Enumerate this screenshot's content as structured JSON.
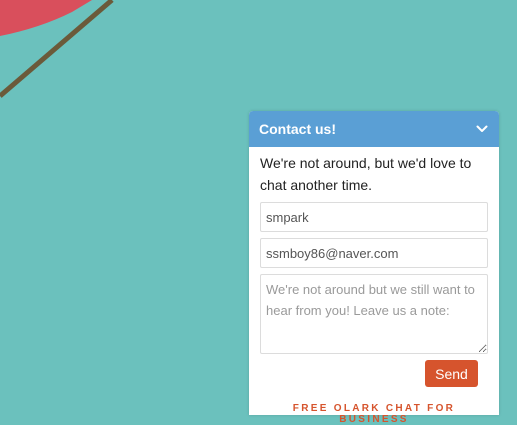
{
  "widget": {
    "title": "Contact us!",
    "away_message": "We're not around, but we'd love to chat another time.",
    "name_value": "smpark",
    "email_value": "ssmboy86@naver.com",
    "note_placeholder": "We're not around but we still want to hear from you! Leave us a note:",
    "send_label": "Send",
    "footer_link": "FREE OLARK CHAT FOR BUSINESS"
  },
  "colors": {
    "background": "#6bc1bd",
    "header": "#5a9fd5",
    "accent": "#d6542d"
  },
  "icons": {
    "collapse": "chevron-down-icon"
  }
}
